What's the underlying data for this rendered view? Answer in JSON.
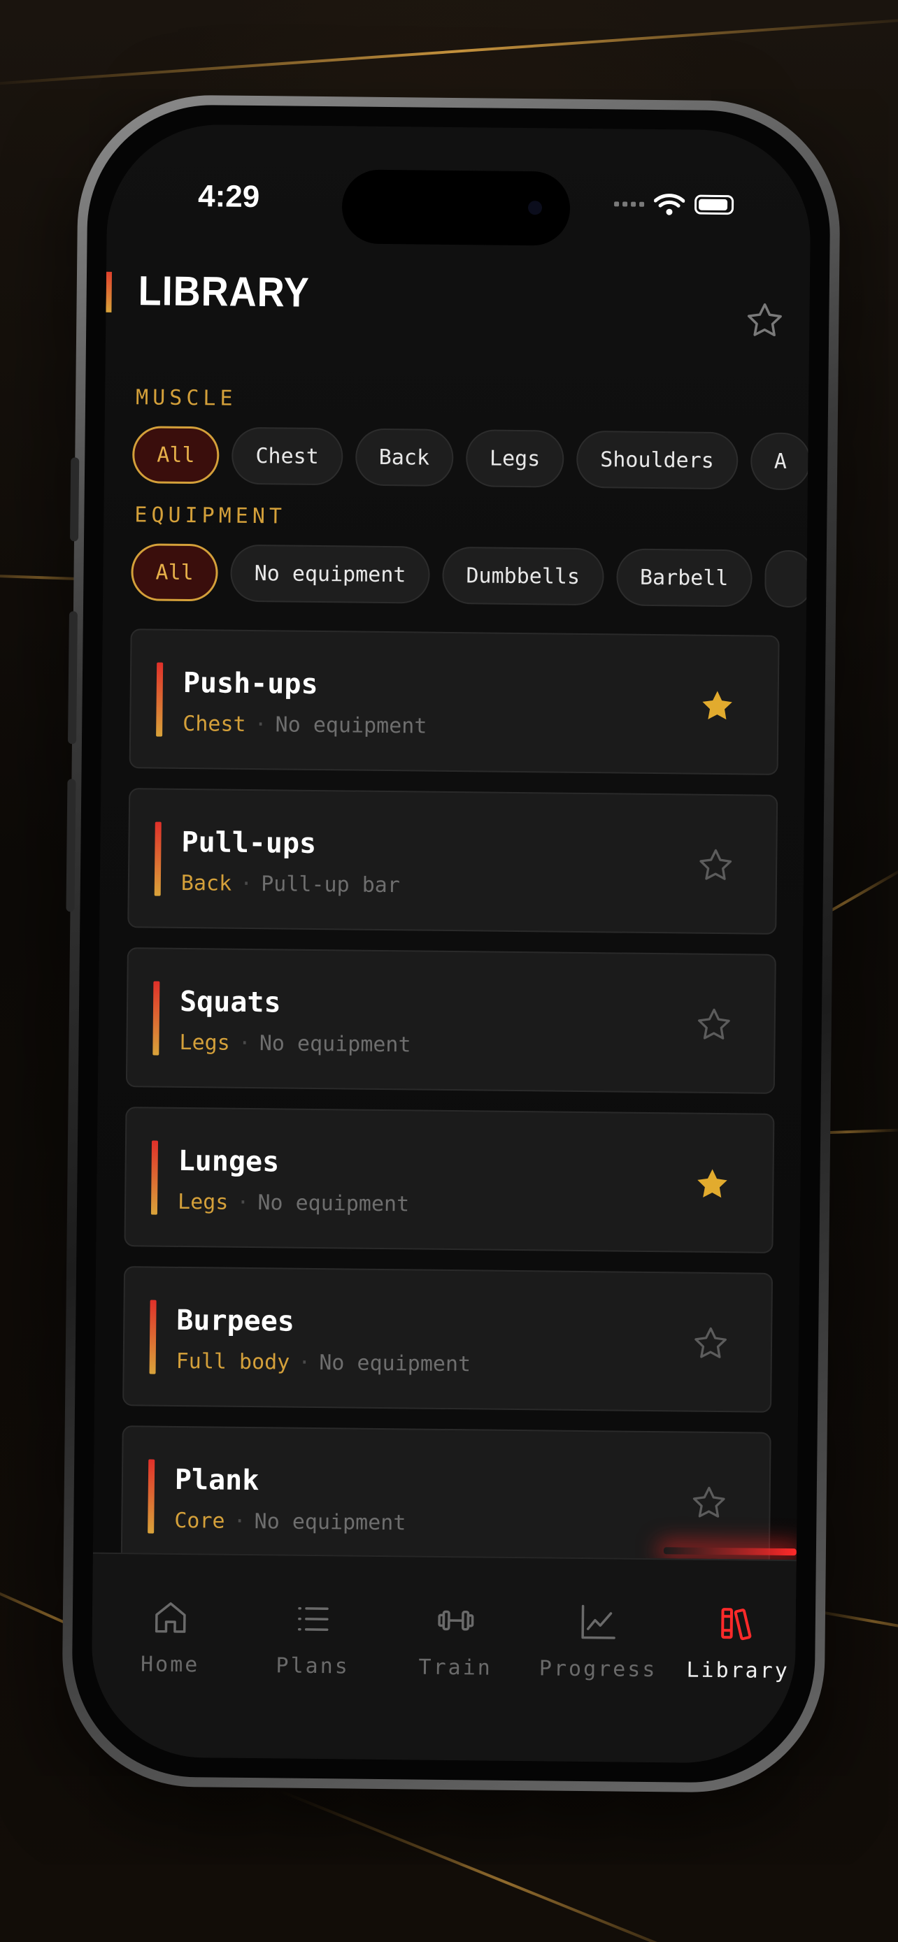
{
  "status_bar": {
    "time": "4:29"
  },
  "header": {
    "title": "LIBRARY"
  },
  "filters": {
    "muscle_label": "MUSCLE",
    "muscle_chips": [
      "All",
      "Chest",
      "Back",
      "Legs",
      "Shoulders",
      "A"
    ],
    "equipment_label": "EQUIPMENT",
    "equipment_chips": [
      "All",
      "No equipment",
      "Dumbbells",
      "Barbell",
      ""
    ]
  },
  "exercises": [
    {
      "name": "Push-ups",
      "muscle": "Chest",
      "equipment": "No equipment",
      "favorite": true
    },
    {
      "name": "Pull-ups",
      "muscle": "Back",
      "equipment": "Pull-up bar",
      "favorite": false
    },
    {
      "name": "Squats",
      "muscle": "Legs",
      "equipment": "No equipment",
      "favorite": false
    },
    {
      "name": "Lunges",
      "muscle": "Legs",
      "equipment": "No equipment",
      "favorite": true
    },
    {
      "name": "Burpees",
      "muscle": "Full body",
      "equipment": "No equipment",
      "favorite": false
    },
    {
      "name": "Plank",
      "muscle": "Core",
      "equipment": "No equipment",
      "favorite": false
    }
  ],
  "tabs": [
    {
      "label": "Home",
      "icon": "home-icon",
      "active": false
    },
    {
      "label": "Plans",
      "icon": "list-icon",
      "active": false
    },
    {
      "label": "Train",
      "icon": "dumbbell-icon",
      "active": false
    },
    {
      "label": "Progress",
      "icon": "chart-icon",
      "active": false
    },
    {
      "label": "Library",
      "icon": "books-icon",
      "active": true
    }
  ],
  "colors": {
    "accent_gold": "#d4a03a",
    "accent_red": "#e0302a",
    "active_tab": "#ff2a2a"
  }
}
